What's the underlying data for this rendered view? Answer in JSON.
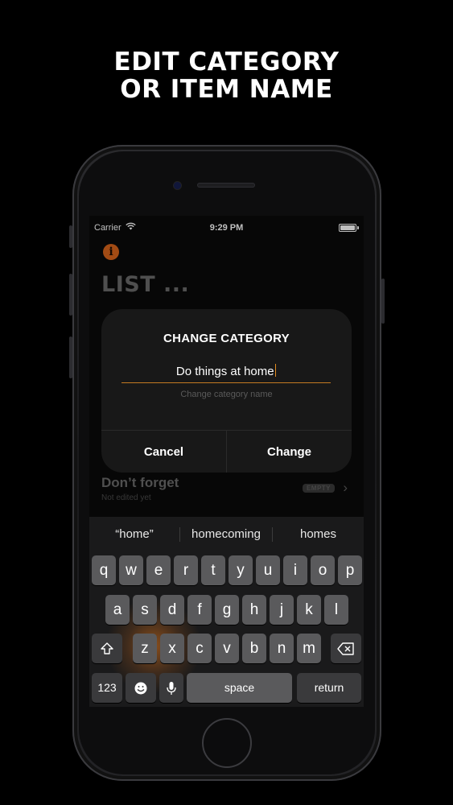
{
  "headline": {
    "line1": "EDIT CATEGORY",
    "line2": "OR ITEM NAME"
  },
  "status_bar": {
    "carrier": "Carrier",
    "time": "9:29 PM"
  },
  "page": {
    "title": "LIST ..."
  },
  "list_row": {
    "name": "Don’t forget",
    "subtitle": "Not edited yet",
    "badge": "EMPTY"
  },
  "alert": {
    "title": "CHANGE CATEGORY",
    "field_value": "Do things at home",
    "hint": "Change category name",
    "cancel_label": "Cancel",
    "change_label": "Change"
  },
  "keyboard": {
    "suggestions": [
      "“home”",
      "homecoming",
      "homes"
    ],
    "row1": [
      "q",
      "w",
      "e",
      "r",
      "t",
      "y",
      "u",
      "i",
      "o",
      "p"
    ],
    "row2": [
      "a",
      "s",
      "d",
      "f",
      "g",
      "h",
      "j",
      "k",
      "l"
    ],
    "row3": [
      "z",
      "x",
      "c",
      "v",
      "b",
      "n",
      "m"
    ],
    "numbers_label": "123",
    "space_label": "space",
    "return_label": "return"
  },
  "colors": {
    "accent": "#d9641b",
    "background": "#000000"
  }
}
